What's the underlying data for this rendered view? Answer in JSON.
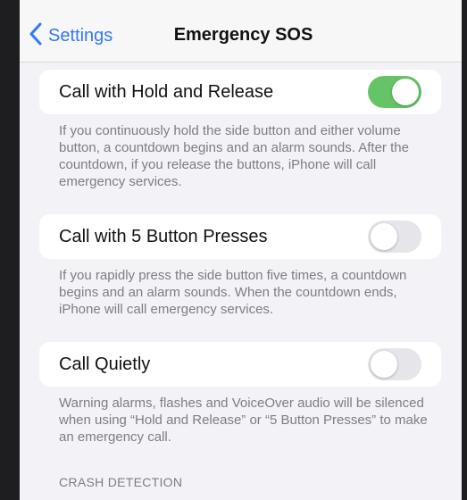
{
  "nav": {
    "back_label": "Settings",
    "title": "Emergency SOS"
  },
  "settings": [
    {
      "label": "Call with Hold and Release",
      "toggle_on": true,
      "footnote": "If you continuously hold the side button and either volume button, a countdown begins and an alarm sounds. After the countdown, if you release the buttons, iPhone will call emergency services."
    },
    {
      "label": "Call with 5 Button Presses",
      "toggle_on": false,
      "footnote": "If you rapidly press the side button five times, a countdown begins and an alarm sounds. When the countdown ends, iPhone will call emergency services."
    },
    {
      "label": "Call Quietly",
      "toggle_on": false,
      "footnote": "Warning alarms, flashes and VoiceOver audio will be silenced when using “Hold and Release” or “5 Button Presses” to make an emergency call."
    }
  ],
  "crash_detection_header": "CRASH DETECTION",
  "colors": {
    "accent": "#3478f6",
    "toggle_on": "#65c466",
    "toggle_off": "#e5e5ea",
    "background": "#f2f2f7"
  },
  "icons": {
    "back": "chevron-left-icon"
  }
}
